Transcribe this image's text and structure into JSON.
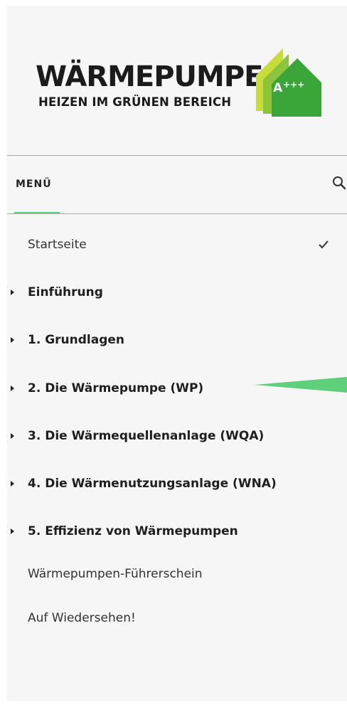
{
  "logo": {
    "title": "WÄRMEPUMPE",
    "subtitle": "HEIZEN IM GRÜNEN BEREICH",
    "rating": "A",
    "rating_suffix": "+++"
  },
  "menu": {
    "tab_label": "MENÜ",
    "search_icon": "search-icon"
  },
  "nav": {
    "items": [
      {
        "label": "Startseite",
        "expandable": false,
        "bold": false,
        "active": true
      },
      {
        "label": "Einführung",
        "expandable": true,
        "bold": true
      },
      {
        "label": "1. Grundlagen",
        "expandable": true,
        "bold": true
      },
      {
        "label": "2. Die Wärmepumpe (WP)",
        "expandable": true,
        "bold": true
      },
      {
        "label": "3. Die Wärmequellenanlage (WQA)",
        "expandable": true,
        "bold": true
      },
      {
        "label": "4. Die Wärmenutzungsanlage (WNA)",
        "expandable": true,
        "bold": true
      },
      {
        "label": "5. Effizienz von Wärmepumpen",
        "expandable": true,
        "bold": true
      },
      {
        "label": "Wärmepumpen-Führerschein",
        "expandable": false,
        "bold": false
      },
      {
        "label": "Auf Wiedersehen!",
        "expandable": false,
        "bold": false
      }
    ]
  },
  "colors": {
    "accent_green": "#5ed07c",
    "logo_green_dark": "#3aa63a",
    "logo_green_mid": "#8cc43c",
    "logo_green_light": "#c8dc3c",
    "panel_bg": "#f6f6f6"
  }
}
